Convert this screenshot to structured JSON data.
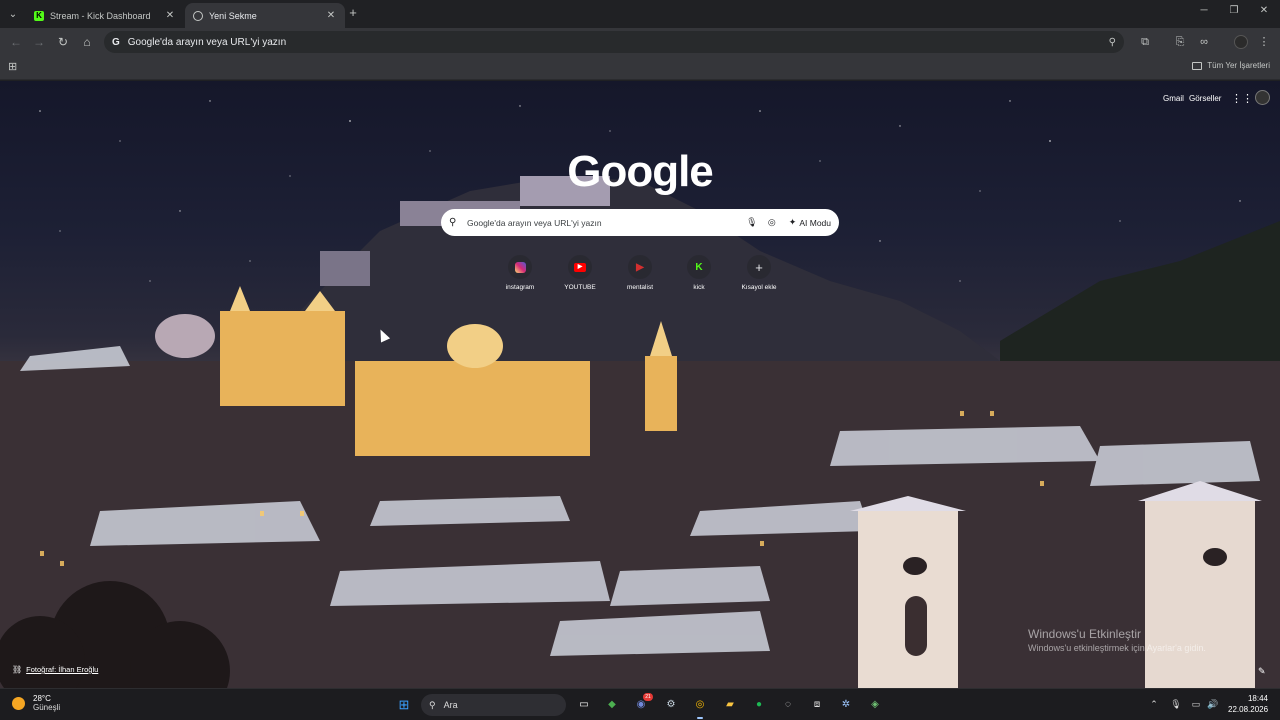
{
  "tabs": [
    {
      "label": "Stream - Kick Dashboard",
      "favicon": "K"
    },
    {
      "label": "Yeni Sekme"
    }
  ],
  "toolbar": {
    "omnibox_text": "Google'da arayın veya URL'yi yazın",
    "omnibox_prefix": "G"
  },
  "bookmarks": {
    "all_bookmarks_label": "Tüm Yer İşaretleri"
  },
  "page": {
    "gmail": "Gmail",
    "images": "Görseller",
    "logo": "Google",
    "search_placeholder": "Google'da arayın veya URL'yi yazın",
    "ai_mode": "AI Modu",
    "shortcuts": [
      {
        "label": "instagram",
        "icon": "instagram-icon",
        "color": "#e1306c"
      },
      {
        "label": "YOUTUBE",
        "icon": "youtube-icon",
        "color": "#ff0000"
      },
      {
        "label": "mentalist",
        "icon": "play-icon",
        "color": "#d32f2f"
      },
      {
        "label": "kick",
        "icon": "kick-icon",
        "color": "#53fc18"
      },
      {
        "label": "Kısayol ekle",
        "icon": "plus-icon",
        "color": "#e8eaed"
      }
    ],
    "photo_credit": "Fotoğraf: İlhan Eroğlu",
    "activation_title": "Windows'u Etkinleştir",
    "activation_sub": "Windows'u etkinleştirmek için Ayarlar'a gidin."
  },
  "taskbar": {
    "temperature": "28°C",
    "weather": "Güneşli",
    "search_label": "Ara",
    "time": "18:44",
    "date": "22.08.2026",
    "discord_badge": "21"
  },
  "colors": {
    "kick_green": "#53fc18",
    "chrome_tab_active": "#35363a",
    "windows_blue": "#0a84ff"
  }
}
